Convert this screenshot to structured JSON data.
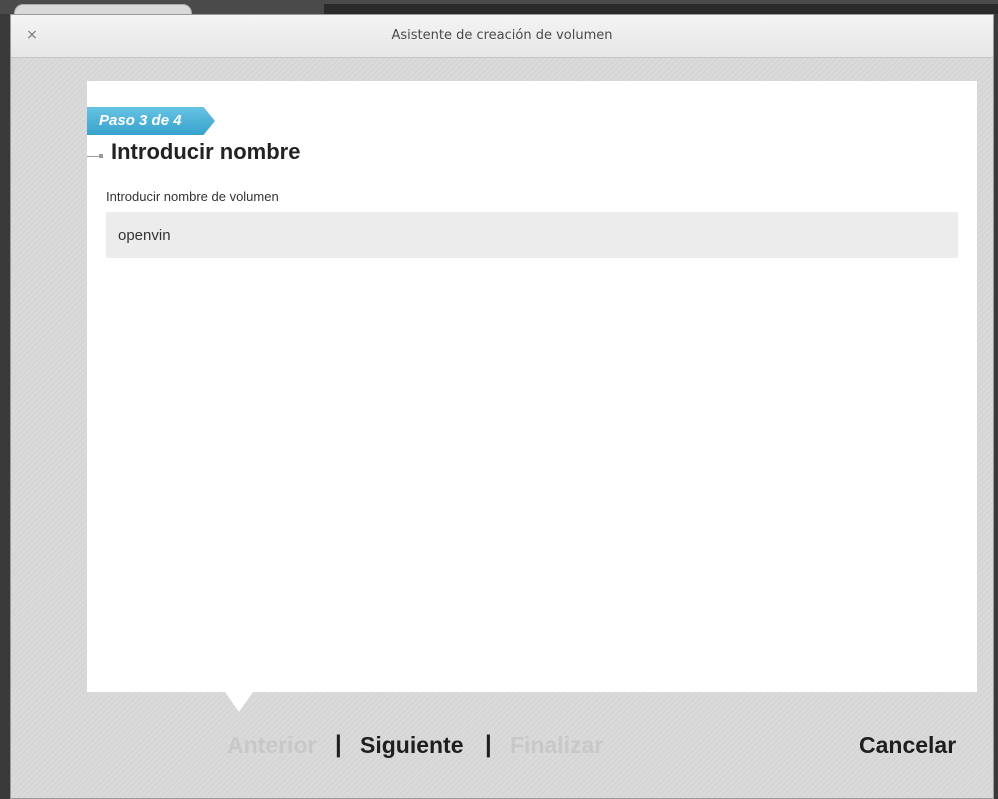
{
  "window": {
    "title": "Asistente de creación de volumen",
    "close_icon": "×"
  },
  "wizard": {
    "step": "Paso 3 de 4",
    "heading": "Introducir nombre",
    "field_label": "Introducir nombre de volumen",
    "field_value": "openvin"
  },
  "nav": {
    "previous": "Anterior",
    "next": "Siguiente",
    "finish": "Finalizar",
    "cancel": "Cancelar",
    "separator": "|"
  },
  "colors": {
    "step_ribbon": "#38a2cc",
    "disabled_text": "#c8c8c8",
    "enabled_text": "#1e1e1e"
  }
}
